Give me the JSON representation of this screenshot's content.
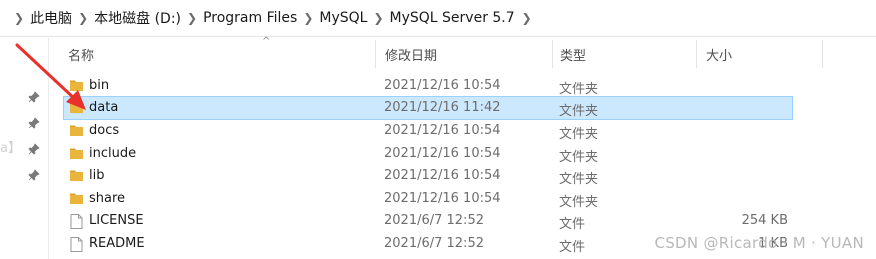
{
  "breadcrumb": {
    "items": [
      "此电脑",
      "本地磁盘 (D:)",
      "Program Files",
      "MySQL",
      "MySQL Server 5.7"
    ]
  },
  "columns": {
    "name": "名称",
    "date": "修改日期",
    "type": "类型",
    "size": "大小"
  },
  "files": [
    {
      "name": "bin",
      "date": "2021/12/16 10:54",
      "type": "文件夹",
      "size": "",
      "kind": "folder",
      "selected": false
    },
    {
      "name": "data",
      "date": "2021/12/16 11:42",
      "type": "文件夹",
      "size": "",
      "kind": "folder",
      "selected": true
    },
    {
      "name": "docs",
      "date": "2021/12/16 10:54",
      "type": "文件夹",
      "size": "",
      "kind": "folder",
      "selected": false
    },
    {
      "name": "include",
      "date": "2021/12/16 10:54",
      "type": "文件夹",
      "size": "",
      "kind": "folder",
      "selected": false
    },
    {
      "name": "lib",
      "date": "2021/12/16 10:54",
      "type": "文件夹",
      "size": "",
      "kind": "folder",
      "selected": false
    },
    {
      "name": "share",
      "date": "2021/12/16 10:54",
      "type": "文件夹",
      "size": "",
      "kind": "folder",
      "selected": false
    },
    {
      "name": "LICENSE",
      "date": "2021/6/7 12:52",
      "type": "文件",
      "size": "254 KB",
      "kind": "file",
      "selected": false
    },
    {
      "name": "README",
      "date": "2021/6/7 12:52",
      "type": "文件",
      "size": "1 KB",
      "kind": "file",
      "selected": false
    }
  ],
  "nav_pane": {
    "pin_count": 4,
    "ghost_text": "a】"
  },
  "watermark": "CSDN @Ricardo · M · YUAN",
  "colors": {
    "selected_bg": "#cce8ff",
    "selected_border": "#99d1ff",
    "folder": "#e9b53d",
    "annotation_arrow": "#e8312a",
    "muted_text": "#6d6d6d"
  }
}
